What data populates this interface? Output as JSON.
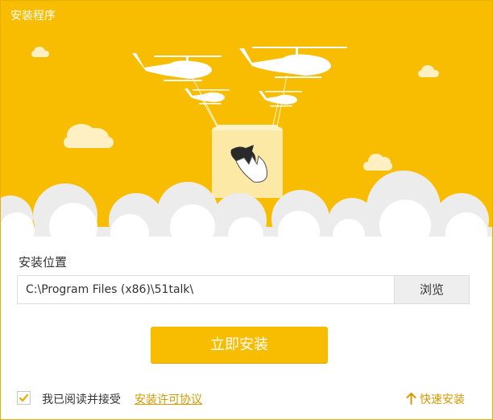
{
  "window": {
    "title": "安装程序"
  },
  "install_location": {
    "label": "安装位置",
    "path_value": "C:\\Program Files (x86)\\51talk\\",
    "browse_label": "浏览"
  },
  "install_button": {
    "label": "立即安装"
  },
  "agreement": {
    "checked": true,
    "text": "我已阅读并接受",
    "link_label": "安装许可协议"
  },
  "quick_install": {
    "label": "快速安装",
    "icon": "arrow-up-icon"
  },
  "colors": {
    "brand": "#f8bd00",
    "link": "#d49a00",
    "cloud": "#ececec"
  }
}
